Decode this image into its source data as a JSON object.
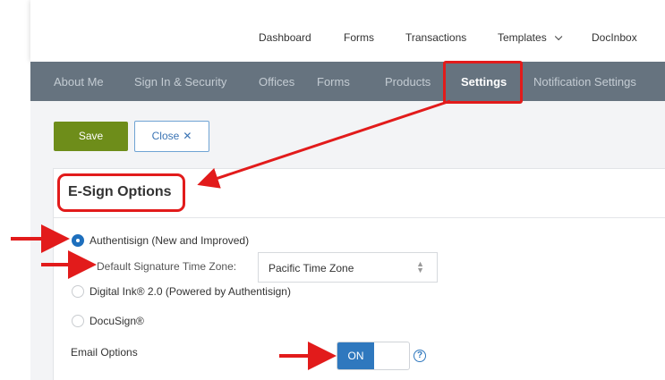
{
  "topnav": {
    "items": [
      "Dashboard",
      "Forms",
      "Transactions",
      "Templates",
      "DocInbox"
    ]
  },
  "subnav": {
    "tabs": [
      "About Me",
      "Sign In & Security",
      "Offices",
      "Forms",
      "Products",
      "Settings",
      "Notification Settings"
    ],
    "active": "Settings"
  },
  "toolbar": {
    "save_label": "Save",
    "close_label": "Close",
    "close_glyph": "✕"
  },
  "esign": {
    "title": "E-Sign Options",
    "options": [
      {
        "label": "Authentisign (New and Improved)",
        "checked": true
      },
      {
        "label": "Digital Ink® 2.0 (Powered by Authentisign)",
        "checked": false
      },
      {
        "label": "DocuSign®",
        "checked": false
      }
    ],
    "timezone_label": "Default Signature Time Zone:",
    "timezone_value": "Pacific Time Zone",
    "email_label": "Email Options",
    "email_toggle": "ON",
    "help_glyph": "?"
  },
  "colors": {
    "accent_blue": "#2f78be",
    "save_green": "#6e8d1a",
    "subnav_bg": "#66737f",
    "annotation_red": "#e21b1b"
  },
  "icons": {
    "templates_dropdown": "chevron-down-icon",
    "close": "close-icon",
    "timezone_spinner": "sort-arrows-icon",
    "help": "help-icon"
  }
}
